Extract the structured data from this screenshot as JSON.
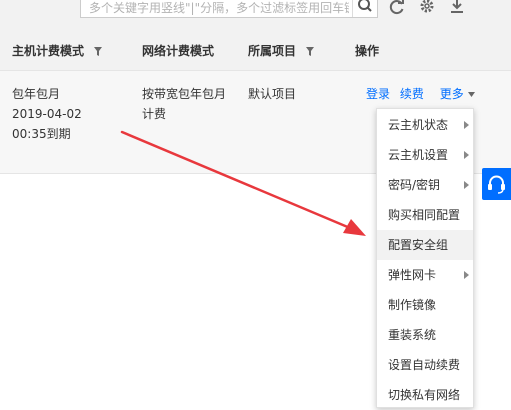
{
  "toolbar": {
    "search_placeholder": "多个关键字用竖线\"|\"分隔，多个过滤标签用回车键分隔",
    "icons": [
      "search-icon",
      "refresh-icon",
      "gear-icon",
      "download-icon"
    ]
  },
  "table": {
    "columns": [
      {
        "label": "主机计费模式",
        "filterable": true
      },
      {
        "label": "网络计费模式",
        "filterable": false
      },
      {
        "label": "所属项目",
        "filterable": true
      },
      {
        "label": "操作",
        "filterable": false
      }
    ],
    "row": {
      "billing_lines": [
        "包年包月",
        "2019-04-02",
        "00:35到期"
      ],
      "network_lines": [
        "按带宽包年包月",
        "计费"
      ],
      "project": "默认项目",
      "actions": {
        "login": "登录",
        "renew": "续费",
        "more": "更多"
      }
    }
  },
  "more_menu": {
    "items": [
      {
        "label": "云主机状态",
        "submenu": true
      },
      {
        "label": "云主机设置",
        "submenu": true
      },
      {
        "label": "密码/密钥",
        "submenu": true
      },
      {
        "label": "购买相同配置",
        "submenu": false
      },
      {
        "label": "配置安全组",
        "submenu": false,
        "highlighted": true
      },
      {
        "label": "弹性网卡",
        "submenu": true
      },
      {
        "label": "制作镜像",
        "submenu": false
      },
      {
        "label": "重装系统",
        "submenu": false
      },
      {
        "label": "设置自动续费",
        "submenu": false
      },
      {
        "label": "切换私有网络",
        "submenu": false
      }
    ]
  },
  "help_button": {
    "icon": "headset-icon"
  },
  "colors": {
    "link": "#006eff",
    "header_bg": "#f2f2f2",
    "annotation_arrow": "#e8383d",
    "help_button": "#006eff"
  }
}
